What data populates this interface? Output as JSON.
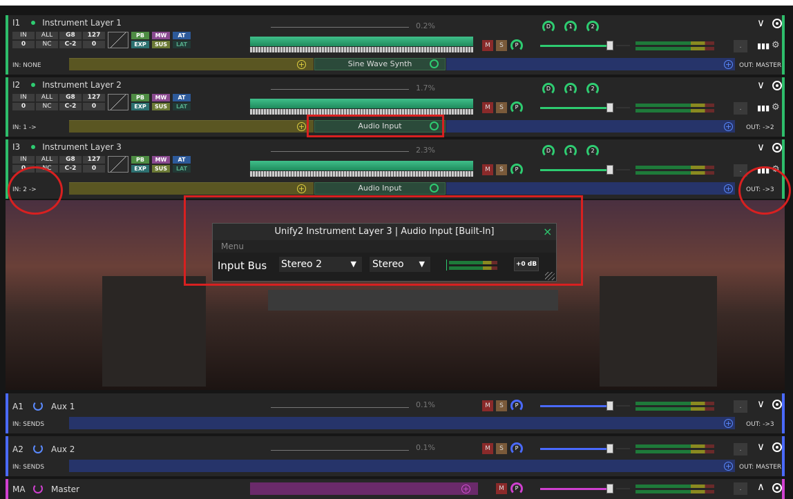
{
  "layers": [
    {
      "id": "I1",
      "name": "Instrument Layer 1",
      "pct": "0.2%",
      "in": "IN: NONE",
      "out": "OUT: MASTER",
      "plugin": "Sine Wave Synth"
    },
    {
      "id": "I2",
      "name": "Instrument Layer 2",
      "pct": "1.7%",
      "in": "IN: 1 ->",
      "out": "OUT: ->2",
      "plugin": "Audio Input"
    },
    {
      "id": "I3",
      "name": "Instrument Layer 3",
      "pct": "2.3%",
      "in": "IN: 2 ->",
      "out": "OUT: ->3",
      "plugin": "Audio Input"
    }
  ],
  "cells": {
    "in": "IN",
    "all": "ALL",
    "g8": "G8",
    "v127": "127",
    "zero": "0",
    "nc": "NC",
    "c2": "C-2",
    "zero2": "0"
  },
  "tags": {
    "pb": "PB",
    "mw": "MW",
    "at": "AT",
    "exp": "EXP",
    "sus": "SUS",
    "lat": "LAT"
  },
  "knobs": {
    "d": "D",
    "one": "1",
    "two": "2"
  },
  "buttons": {
    "m": "M",
    "s": "S",
    "p": "P",
    "dot": "."
  },
  "aux": [
    {
      "id": "A1",
      "name": "Aux 1",
      "pct": "0.1%",
      "in": "IN: SENDS",
      "out": "OUT: ->3"
    },
    {
      "id": "A2",
      "name": "Aux 2",
      "pct": "0.1%",
      "in": "IN: SENDS",
      "out": "OUT: MASTER"
    }
  ],
  "master": {
    "id": "MA",
    "name": "Master"
  },
  "dialog": {
    "title": "Unify2 Instrument Layer 3 | Audio Input [Built-In]",
    "menu": "Menu",
    "input_bus_label": "Input Bus",
    "bus_value": "Stereo 2",
    "mode_value": "Stereo",
    "gain": "+0 dB",
    "close": "×"
  },
  "colors": {
    "accent": "#2ecc71",
    "aux": "#4a6aff",
    "master": "#d040d0",
    "highlight": "#d82020"
  }
}
